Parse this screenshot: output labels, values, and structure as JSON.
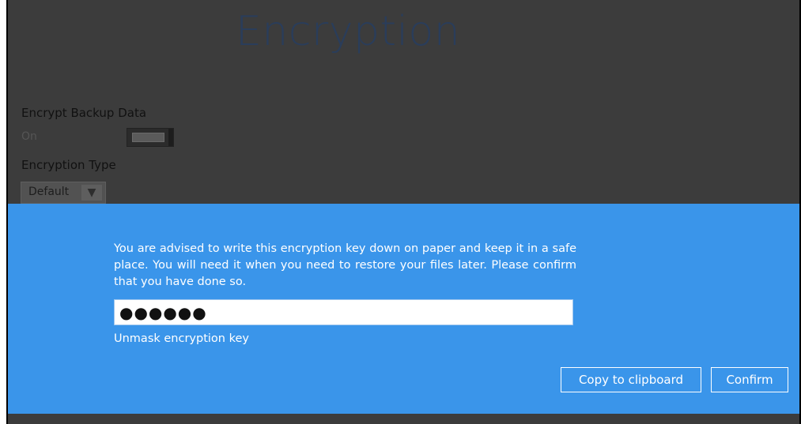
{
  "page": {
    "title": "Encryption"
  },
  "settings": {
    "encrypt_label": "Encrypt Backup Data",
    "encrypt_state": "On",
    "encryption_type_label": "Encryption Type",
    "encryption_type_value": "Default"
  },
  "dialog": {
    "message": "You are advised to write this encryption key down on paper and keep it in a safe place. You will need it when you need to restore your files later. Please confirm that you have done so.",
    "key_value": "●●●●●●",
    "unmask_label": "Unmask encryption key",
    "copy_button": "Copy to clipboard",
    "confirm_button": "Confirm"
  },
  "colors": {
    "overlay": "#3c3c3c",
    "dialog_bg": "#3a95ea",
    "title": "#2a3d5a"
  }
}
